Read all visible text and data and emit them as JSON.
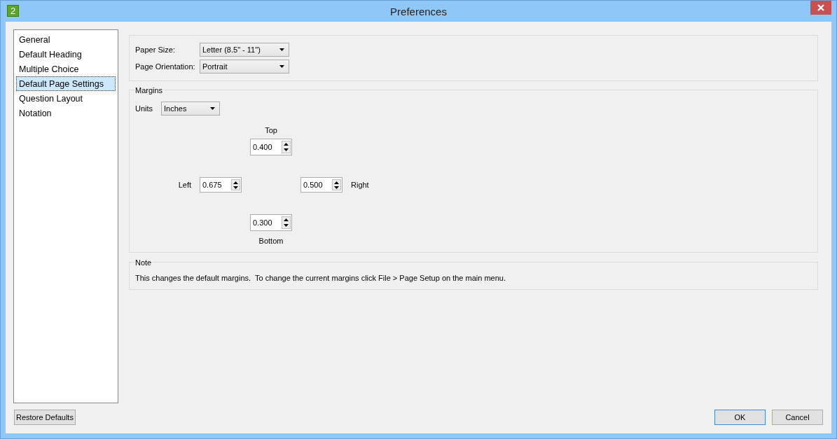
{
  "window": {
    "icon_text": "2",
    "title": "Preferences"
  },
  "sidebar": {
    "items": [
      {
        "label": "General",
        "selected": false
      },
      {
        "label": "Default Heading",
        "selected": false
      },
      {
        "label": "Multiple Choice",
        "selected": false
      },
      {
        "label": "Default Page Settings",
        "selected": true
      },
      {
        "label": "Question Layout",
        "selected": false
      },
      {
        "label": "Notation",
        "selected": false
      }
    ]
  },
  "page_setup": {
    "fields": [
      {
        "label": "Paper Size:",
        "value": "Letter (8.5\" - 11\")"
      },
      {
        "label": "Page Orientation:",
        "value": "Portrait"
      }
    ]
  },
  "margins": {
    "title": "Margins",
    "units": {
      "label": "Units",
      "value": "Inches"
    },
    "top": {
      "label": "Top",
      "value": "0.400"
    },
    "left": {
      "label": "Left",
      "value": "0.675"
    },
    "right": {
      "label": "Right",
      "value": "0.500"
    },
    "bottom": {
      "label": "Bottom",
      "value": "0.300"
    }
  },
  "note": {
    "title": "Note",
    "text": "This changes the default margins.  To change the current margins click File > Page Setup on the main menu."
  },
  "restore_button": {
    "label": "Restore Defaults"
  },
  "dialog_buttons": [
    {
      "label": "OK",
      "default": true
    },
    {
      "label": "Cancel",
      "default": false
    }
  ]
}
